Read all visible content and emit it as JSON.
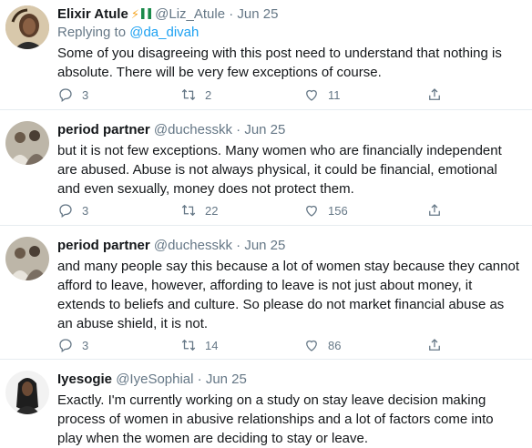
{
  "tweets": [
    {
      "name": "Elixir Atule",
      "handle": "@Liz_Atule",
      "dot": "·",
      "time": "Jun 25",
      "replying_prefix": "Replying to ",
      "replying_to": "@da_divah",
      "text": "Some of you disagreeing with this post need to understand that nothing is absolute. There will be very few exceptions of course.",
      "replies": "3",
      "retweets": "2",
      "likes": "11"
    },
    {
      "name": "period partner",
      "handle": "@duchesskk",
      "dot": "·",
      "time": "Jun 25",
      "text": "but it is not few exceptions. Many women who are financially independent are abused. Abuse is not always physical, it could be financial, emotional and even sexually, money does not protect them.",
      "replies": "3",
      "retweets": "22",
      "likes": "156"
    },
    {
      "name": "period partner",
      "handle": "@duchesskk",
      "dot": "·",
      "time": "Jun 25",
      "text": "and many people say this because a lot of women stay because they cannot afford to leave, however, affording to leave is not just about money, it extends to beliefs and culture. So please do not market financial abuse as an abuse shield, it is not.",
      "replies": "3",
      "retweets": "14",
      "likes": "86"
    },
    {
      "name": "Iyesogie",
      "handle": "@IyeSophial",
      "dot": "·",
      "time": "Jun 25",
      "text": "Exactly. I'm currently working on a study on stay leave decision making process of women in abusive relationships and a lot of factors come into play when the women are deciding to stay or leave."
    }
  ],
  "colors": {
    "text": "#14171a",
    "secondary": "#657786",
    "link": "#1da1f2",
    "divider": "#e6ecf0"
  },
  "icons": [
    "reply-icon",
    "retweet-icon",
    "like-icon",
    "share-icon",
    "lightning-icon",
    "nigeria-flag-icon"
  ]
}
